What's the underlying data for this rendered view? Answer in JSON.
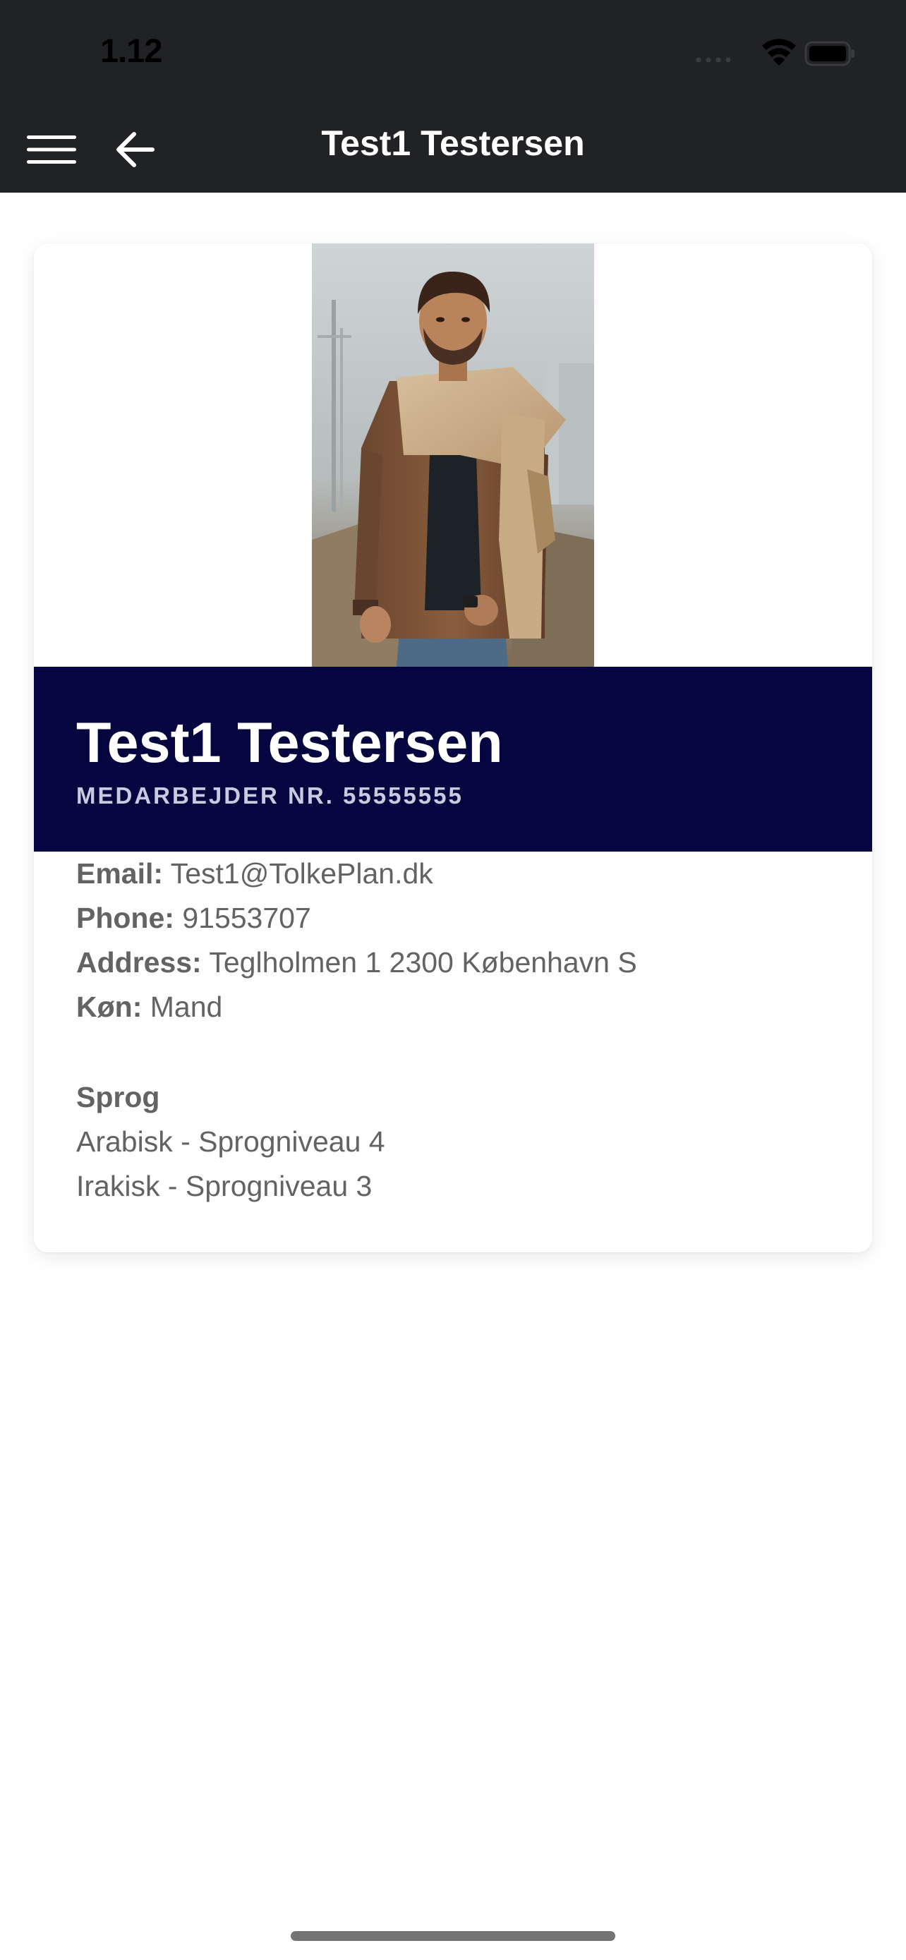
{
  "status_bar": {
    "time": "1.12",
    "icons": [
      "signal-icon",
      "wifi-icon",
      "battery-icon"
    ]
  },
  "nav": {
    "title": "Test1 Testersen",
    "menu_icon": "hamburger-menu-icon",
    "back_icon": "arrow-left-icon"
  },
  "profile": {
    "photo_alt": "Profile photo",
    "name": "Test1 Testersen",
    "employee_number": "MEDARBEJDER NR. 55555555",
    "band_color": "#05053f"
  },
  "details": {
    "email_label": "Email:",
    "email": "Test1@TolkePlan.dk",
    "phone_label": "Phone:",
    "phone": "91553707",
    "address_label": "Address:",
    "address": "Teglholmen 1 2300 København S",
    "gender_label": "Køn:",
    "gender": "Mand"
  },
  "languages": {
    "heading": "Sprog",
    "items": [
      "Arabisk - Sprogniveau 4",
      "Irakisk - Sprogniveau 3"
    ]
  },
  "colors": {
    "chrome": "#212226",
    "card_band": "#05053f",
    "body_text": "#636363"
  }
}
